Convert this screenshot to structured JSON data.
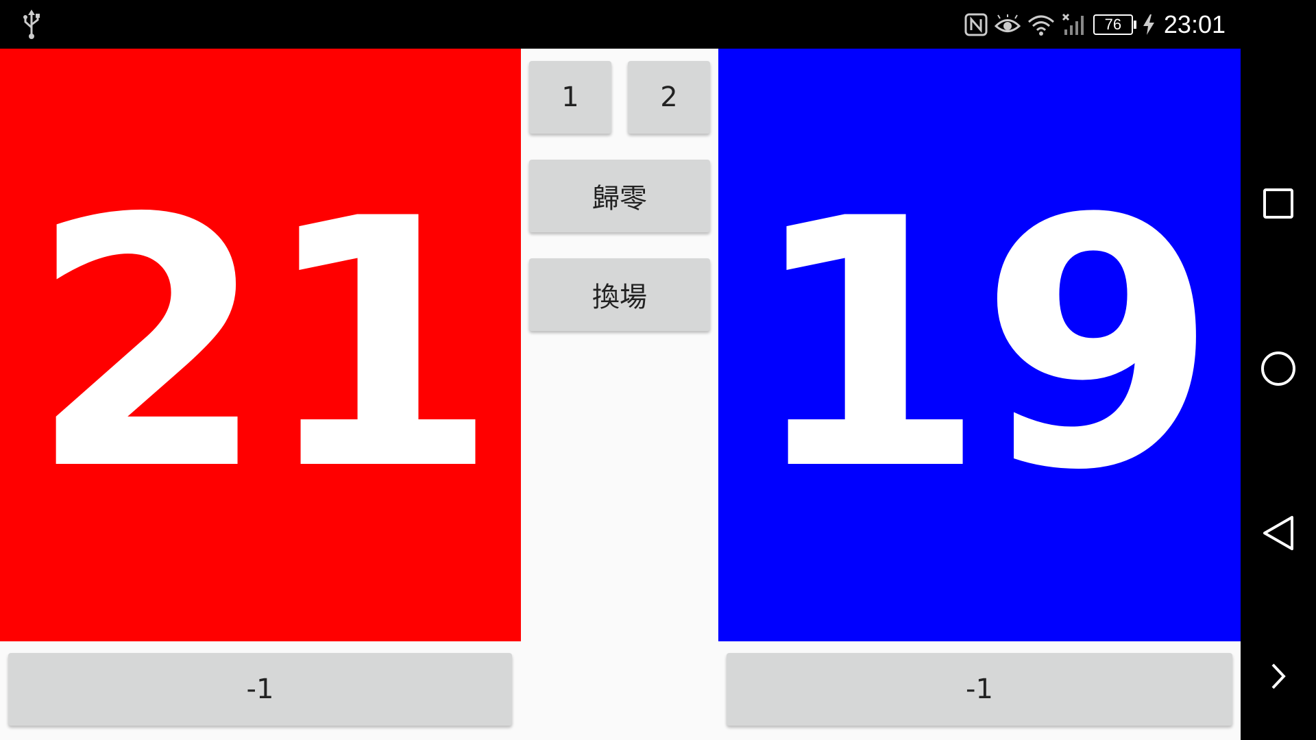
{
  "status_bar": {
    "usb_icon": "usb-icon",
    "nfc_icon": "nfc-icon",
    "eye_icon": "eye-comfort-icon",
    "wifi_icon": "wifi-icon",
    "signal_icon": "no-signal-icon",
    "battery_level": "76",
    "charging_icon": "charging-bolt-icon",
    "time": "23:01"
  },
  "scoreboard": {
    "left": {
      "score": "21",
      "color": "#ff0000"
    },
    "right": {
      "score": "19",
      "color": "#0000ff"
    }
  },
  "controls": {
    "set_1_label": "1",
    "set_2_label": "2",
    "reset_label": "歸零",
    "swap_label": "換場",
    "left_minus_label": "-1",
    "right_minus_label": "-1"
  },
  "nav_bar": {
    "recent_icon": "recent-apps-icon",
    "home_icon": "home-icon",
    "back_icon": "back-icon",
    "more_icon": "chevron-right-icon"
  }
}
